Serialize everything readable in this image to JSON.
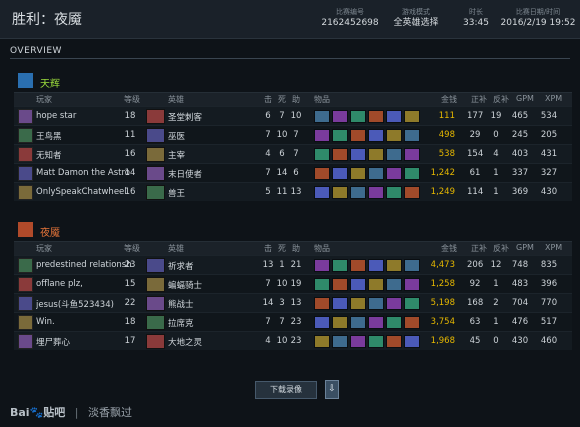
{
  "header": {
    "title": "胜利：夜魇",
    "match_id_label": "比赛编号",
    "match_id": "2162452698",
    "mode_label": "游戏模式",
    "mode": "全英雄选择",
    "duration_label": "时长",
    "duration": "33:45",
    "date_label": "比赛日期/时间",
    "date": "2016/2/19 19:52"
  },
  "overview_label": "OVERVIEW",
  "columns": {
    "player": "玩家",
    "level": "等级",
    "hero": "英雄",
    "kills": "击",
    "deaths": "死",
    "assists": "助",
    "items": "物品",
    "gold": "金钱",
    "lh": "正补",
    "dn": "反补",
    "gpm": "GPM",
    "xpm": "XPM"
  },
  "teams": [
    {
      "name": "天辉",
      "color": "#9bdc3c",
      "players": [
        {
          "name": "hope star",
          "level": "18",
          "hero": "圣堂刺客",
          "k": "6",
          "d": "7",
          "a": "10",
          "gold": "111",
          "lh": "177",
          "dn": "19",
          "gpm": "465",
          "xpm": "534"
        },
        {
          "name": "王鸟黑",
          "level": "11",
          "hero": "巫医",
          "k": "7",
          "d": "10",
          "a": "7",
          "gold": "498",
          "lh": "29",
          "dn": "0",
          "gpm": "245",
          "xpm": "205"
        },
        {
          "name": "无知者",
          "level": "16",
          "hero": "主宰",
          "k": "4",
          "d": "6",
          "a": "7",
          "gold": "538",
          "lh": "154",
          "dn": "4",
          "gpm": "403",
          "xpm": "431"
        },
        {
          "name": "Matt Damon the Astro",
          "level": "14",
          "hero": "末日使者",
          "k": "7",
          "d": "14",
          "a": "6",
          "gold": "1,242",
          "lh": "61",
          "dn": "1",
          "gpm": "337",
          "xpm": "327"
        },
        {
          "name": "OnlySpeakChatwheel",
          "level": "16",
          "hero": "兽王",
          "k": "5",
          "d": "11",
          "a": "13",
          "gold": "1,249",
          "lh": "114",
          "dn": "1",
          "gpm": "369",
          "xpm": "430"
        }
      ]
    },
    {
      "name": "夜魇",
      "color": "#e8763a",
      "players": [
        {
          "name": "predestined relationsh",
          "level": "23",
          "hero": "祈求者",
          "k": "13",
          "d": "1",
          "a": "21",
          "gold": "4,473",
          "lh": "206",
          "dn": "12",
          "gpm": "748",
          "xpm": "835"
        },
        {
          "name": "offlane plz,",
          "level": "15",
          "hero": "蝙蝠骑士",
          "k": "7",
          "d": "10",
          "a": "19",
          "gold": "1,258",
          "lh": "92",
          "dn": "1",
          "gpm": "483",
          "xpm": "396"
        },
        {
          "name": "jesus(斗鱼523434)",
          "level": "22",
          "hero": "熊战士",
          "k": "14",
          "d": "3",
          "a": "13",
          "gold": "5,198",
          "lh": "168",
          "dn": "2",
          "gpm": "704",
          "xpm": "770"
        },
        {
          "name": "Win.",
          "level": "18",
          "hero": "拉席克",
          "k": "7",
          "d": "7",
          "a": "23",
          "gold": "3,754",
          "lh": "63",
          "dn": "1",
          "gpm": "476",
          "xpm": "517"
        },
        {
          "name": "埋尸葬心",
          "level": "17",
          "hero": "大地之灵",
          "k": "4",
          "d": "10",
          "a": "23",
          "gold": "1,968",
          "lh": "45",
          "dn": "0",
          "gpm": "430",
          "xpm": "460"
        }
      ]
    }
  ],
  "download_button": "下载录像",
  "watermark": {
    "brand": "Bai🐾贴吧",
    "separator": "|",
    "user": "淡香飘过"
  }
}
